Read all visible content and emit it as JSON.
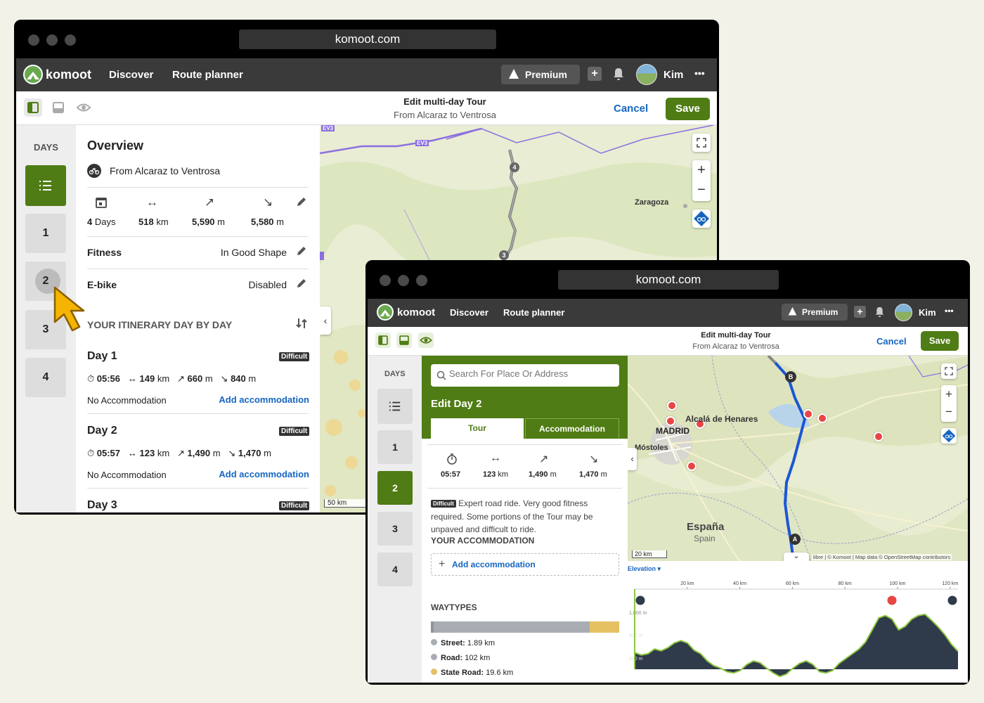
{
  "w1": {
    "url": "komoot.com",
    "app": {
      "brand": "komoot",
      "discover": "Discover",
      "route_planner": "Route planner",
      "premium": "Premium",
      "plus": "+",
      "user": "Kim",
      "more": "•••"
    },
    "toolbar": {
      "title": "Edit multi-day Tour",
      "subtitle": "From Alcaraz to Ventrosa",
      "cancel": "Cancel",
      "save": "Save"
    },
    "days": {
      "header": "DAYS",
      "list_icon": "☰",
      "items": [
        "1",
        "2",
        "3",
        "4"
      ]
    },
    "overview": {
      "title": "Overview",
      "tour_name": "From Alcaraz to Ventrosa",
      "stats": [
        {
          "icon": "calendar-icon",
          "value": "4",
          "unit": "Days"
        },
        {
          "icon": "distance-icon",
          "value": "518",
          "unit": "km"
        },
        {
          "icon": "ascent-icon",
          "value": "5,590",
          "unit": "m"
        },
        {
          "icon": "descent-icon",
          "value": "5,580",
          "unit": "m"
        }
      ],
      "fitness_label": "Fitness",
      "fitness_value": "In Good Shape",
      "ebike_label": "E-bike",
      "ebike_value": "Disabled",
      "itinerary_header": "YOUR ITINERARY DAY BY DAY",
      "day_list": [
        {
          "title": "Day 1",
          "badge": "Difficult",
          "time": "05:56",
          "dist": "149",
          "up": "660",
          "down": "840",
          "acc": "No Accommodation",
          "add": "Add accommodation"
        },
        {
          "title": "Day 2",
          "badge": "Difficult",
          "time": "05:57",
          "dist": "123",
          "up": "1,490",
          "down": "1,470",
          "acc": "No Accommodation",
          "add": "Add accommodation"
        },
        {
          "title": "Day 3",
          "badge": "Difficult"
        }
      ],
      "units": {
        "km": "km",
        "m": "m"
      }
    },
    "map": {
      "zaragoza": "Zaragoza",
      "scale": "50 km",
      "ev3": "EV3",
      "wp4": "4",
      "wp3": "3",
      "zoom_in": "+",
      "zoom_out": "−"
    }
  },
  "w2": {
    "url": "komoot.com",
    "app": {
      "brand": "komoot",
      "discover": "Discover",
      "route_planner": "Route planner",
      "premium": "Premium",
      "plus": "+",
      "user": "Kim",
      "more": "•••"
    },
    "toolbar": {
      "title": "Edit multi-day Tour",
      "subtitle": "From Alcaraz to Ventrosa",
      "cancel": "Cancel",
      "save": "Save"
    },
    "days": {
      "header": "DAYS",
      "list_icon": "☰",
      "items": [
        "1",
        "2",
        "3",
        "4"
      ],
      "active": "2"
    },
    "panel": {
      "search_placeholder": "Search For Place Or Address",
      "title": "Edit Day 2",
      "tab_tour": "Tour",
      "tab_acc": "Accommodation",
      "stats": [
        {
          "icon": "duration-icon",
          "value": "05:57"
        },
        {
          "icon": "distance-icon",
          "value": "123",
          "unit": "km"
        },
        {
          "icon": "ascent-icon",
          "value": "1,490",
          "unit": "m"
        },
        {
          "icon": "descent-icon",
          "value": "1,470",
          "unit": "m"
        }
      ],
      "badge": "Difficult",
      "description": "Expert road ride. Very good fitness required. Some portions of the Tour may be unpaved and difficult to ride.",
      "acc_header": "YOUR ACCOMMODATION",
      "add_acc": "Add accommodation",
      "waytypes_header": "WAYTYPES",
      "waytypes": [
        {
          "name": "Street:",
          "value": "1.89 km",
          "color": "#a8acb3",
          "fraction": 0.015
        },
        {
          "name": "Road:",
          "value": "102 km",
          "color": "#a8acb3",
          "fraction": 0.83
        },
        {
          "name": "State Road:",
          "value": "19.6 km",
          "color": "#e5c163",
          "fraction": 0.155
        }
      ]
    },
    "map": {
      "city1": "Alcalá de Henares",
      "city2": "MADRID",
      "city3": "Móstoles",
      "country": "España",
      "country_sub": "Spain",
      "scale": "20 km",
      "attribution": "libre | © Komoot | Map data © OpenStreetMap contributors",
      "marker_a": "A",
      "marker_b": "B",
      "zoom_in": "+",
      "zoom_out": "−"
    },
    "elevation": {
      "title": "Elevation ▾",
      "x_ticks": [
        "20 km",
        "40 km",
        "60 km",
        "80 km",
        "100 km",
        "120 km"
      ],
      "y_ticks": [
        "1,000 m",
        "800 m",
        "600 m"
      ]
    }
  },
  "colors": {
    "brand_green": "#4f7c14",
    "link_blue": "#1565c0",
    "route_blue": "#1c56d6",
    "poi_red": "#e84545"
  }
}
